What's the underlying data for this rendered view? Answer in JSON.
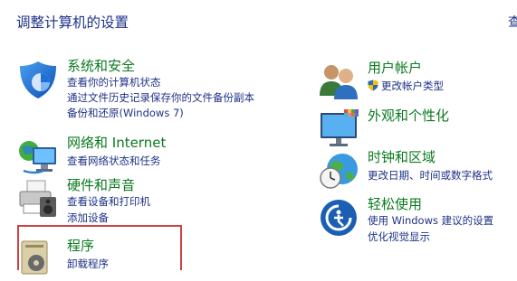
{
  "page": {
    "title": "调整计算机的设置",
    "right_cutoff": "查"
  },
  "left": [
    {
      "heading": "系统和安全",
      "links": [
        "查看你的计算机状态",
        "通过文件历史记录保存你的文件备份副本",
        "备份和还原(Windows 7)"
      ],
      "icon": "shield-icon"
    },
    {
      "heading": "网络和 Internet",
      "links": [
        "查看网络状态和任务"
      ],
      "icon": "network-icon"
    },
    {
      "heading": "硬件和声音",
      "links": [
        "查看设备和打印机",
        "添加设备"
      ],
      "icon": "printer-icon"
    },
    {
      "heading": "程序",
      "links": [
        "卸载程序"
      ],
      "icon": "programs-icon"
    }
  ],
  "right": [
    {
      "heading": "用户帐户",
      "links": [
        "更改帐户类型"
      ],
      "icon": "users-icon"
    },
    {
      "heading": "外观和个性化",
      "links": [],
      "icon": "monitor-icon"
    },
    {
      "heading": "时钟和区域",
      "links": [
        "更改日期、时间或数字格式"
      ],
      "icon": "clock-globe-icon"
    },
    {
      "heading": "轻松使用",
      "links": [
        "使用 Windows 建议的设置",
        "优化视觉显示"
      ],
      "icon": "ease-of-access-icon"
    }
  ],
  "colors": {
    "heading": "#0b7a1e",
    "link": "#1e3287",
    "selection": "#d04040"
  }
}
